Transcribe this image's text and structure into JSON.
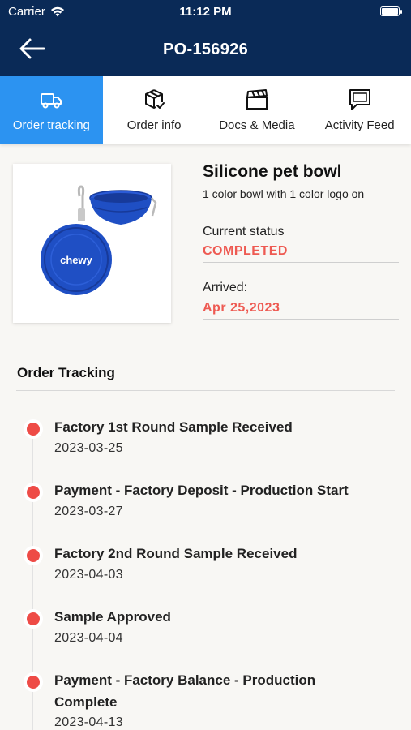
{
  "status_bar": {
    "carrier": "Carrier",
    "time": "11:12 PM"
  },
  "nav": {
    "title": "PO-156926",
    "back_icon": "arrow-left-icon"
  },
  "tabs": [
    {
      "label": "Order tracking",
      "icon": "truck-icon",
      "active": true
    },
    {
      "label": "Order info",
      "icon": "box-check-icon",
      "active": false
    },
    {
      "label": "Docs & Media",
      "icon": "clapperboard-icon",
      "active": false
    },
    {
      "label": "Activity Feed",
      "icon": "message-icon",
      "active": false
    }
  ],
  "product": {
    "name": "Silicone pet bowl",
    "description": "1 color bowl with 1 color logo on",
    "image_logo_text": "chewy",
    "current_status_label": "Current status",
    "current_status": "COMPLETED",
    "arrived_label": "Arrived:",
    "arrived": "Apr 25,2023"
  },
  "tracking": {
    "title": "Order Tracking",
    "events": [
      {
        "title": "Factory 1st Round Sample Received",
        "date": "2023-03-25"
      },
      {
        "title": "Payment - Factory Deposit - Production Start",
        "date": "2023-03-27"
      },
      {
        "title": "Factory 2nd Round Sample Received",
        "date": "2023-04-03"
      },
      {
        "title": "Sample Approved",
        "date": "2023-04-04"
      },
      {
        "title": "Payment - Factory Balance - Production Complete",
        "date": "2023-04-13"
      }
    ]
  },
  "colors": {
    "navy": "#0a2a57",
    "active_tab": "#2c93f1",
    "accent_red": "#ee5a52",
    "bowl_blue": "#1f4fc4"
  }
}
